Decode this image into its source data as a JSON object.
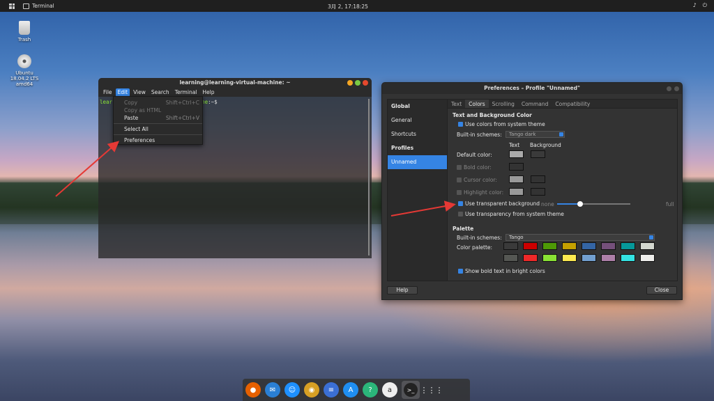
{
  "topbar": {
    "app_title": "Terminal",
    "clock": "3月 2, 17:18:25",
    "tray_icons": [
      "speaker-icon",
      "power-icon"
    ]
  },
  "desktop": {
    "trash_label": "Trash",
    "disc_label_1": "Ubuntu",
    "disc_label_2": "18.04.2 LTS",
    "disc_label_3": "amd64"
  },
  "terminal": {
    "title": "learning@learning-virtual-machine: ~",
    "menus": [
      "File",
      "Edit",
      "View",
      "Search",
      "Terminal",
      "Help"
    ],
    "prompt_user": "lear",
    "prompt_host_tail": "ne",
    "prompt_rest": ":~$"
  },
  "edit_menu": {
    "copy": "Copy",
    "copy_shortcut": "Shift+Ctrl+C",
    "copy_html": "Copy as HTML",
    "paste": "Paste",
    "paste_shortcut": "Shift+Ctrl+V",
    "select_all": "Select All",
    "preferences": "Preferences"
  },
  "prefs": {
    "title": "Preferences – Profile \"Unnamed\"",
    "sidebar": {
      "global": "Global",
      "general": "General",
      "shortcuts": "Shortcuts",
      "profiles": "Profiles",
      "unnamed": "Unnamed"
    },
    "tabs": [
      "Text",
      "Colors",
      "Scrolling",
      "Command",
      "Compatibility"
    ],
    "section_text_bg": "Text and Background Color",
    "use_system_colors": "Use colors from system theme",
    "builtin_schemes_label": "Built-in schemes:",
    "builtin_scheme_value": "Tango dark",
    "col_text": "Text",
    "col_background": "Background",
    "default_color": "Default color:",
    "bold_color": "Bold color:",
    "cursor_color": "Cursor color:",
    "highlight_color": "Highlight color:",
    "use_transparent_bg": "Use transparent background",
    "slider_none": "none",
    "slider_full": "full",
    "transparency_level": 0.3,
    "use_system_transparency": "Use transparency from system theme",
    "section_palette": "Palette",
    "palette_schemes_label": "Built-in schemes:",
    "palette_scheme_value": "Tango",
    "color_palette_label": "Color palette:",
    "palette_row1": [
      "#3a3a3a",
      "#cc0000",
      "#4e9a06",
      "#c4a000",
      "#3465a4",
      "#75507b",
      "#06989a",
      "#d3d7cf"
    ],
    "palette_row2": [
      "#555753",
      "#ef2929",
      "#8ae234",
      "#fce94f",
      "#729fcf",
      "#ad7fa8",
      "#34e2e2",
      "#eeeeec"
    ],
    "show_bold_bright": "Show bold text in bright colors",
    "help_button": "Help",
    "close_button": "Close"
  },
  "dock": [
    "firefox-icon",
    "mail-icon",
    "finder-icon",
    "rhythmbox-icon",
    "docs-icon",
    "appstore-icon",
    "help-icon",
    "amazon-icon",
    "terminal-icon",
    "apps-grid-icon"
  ]
}
